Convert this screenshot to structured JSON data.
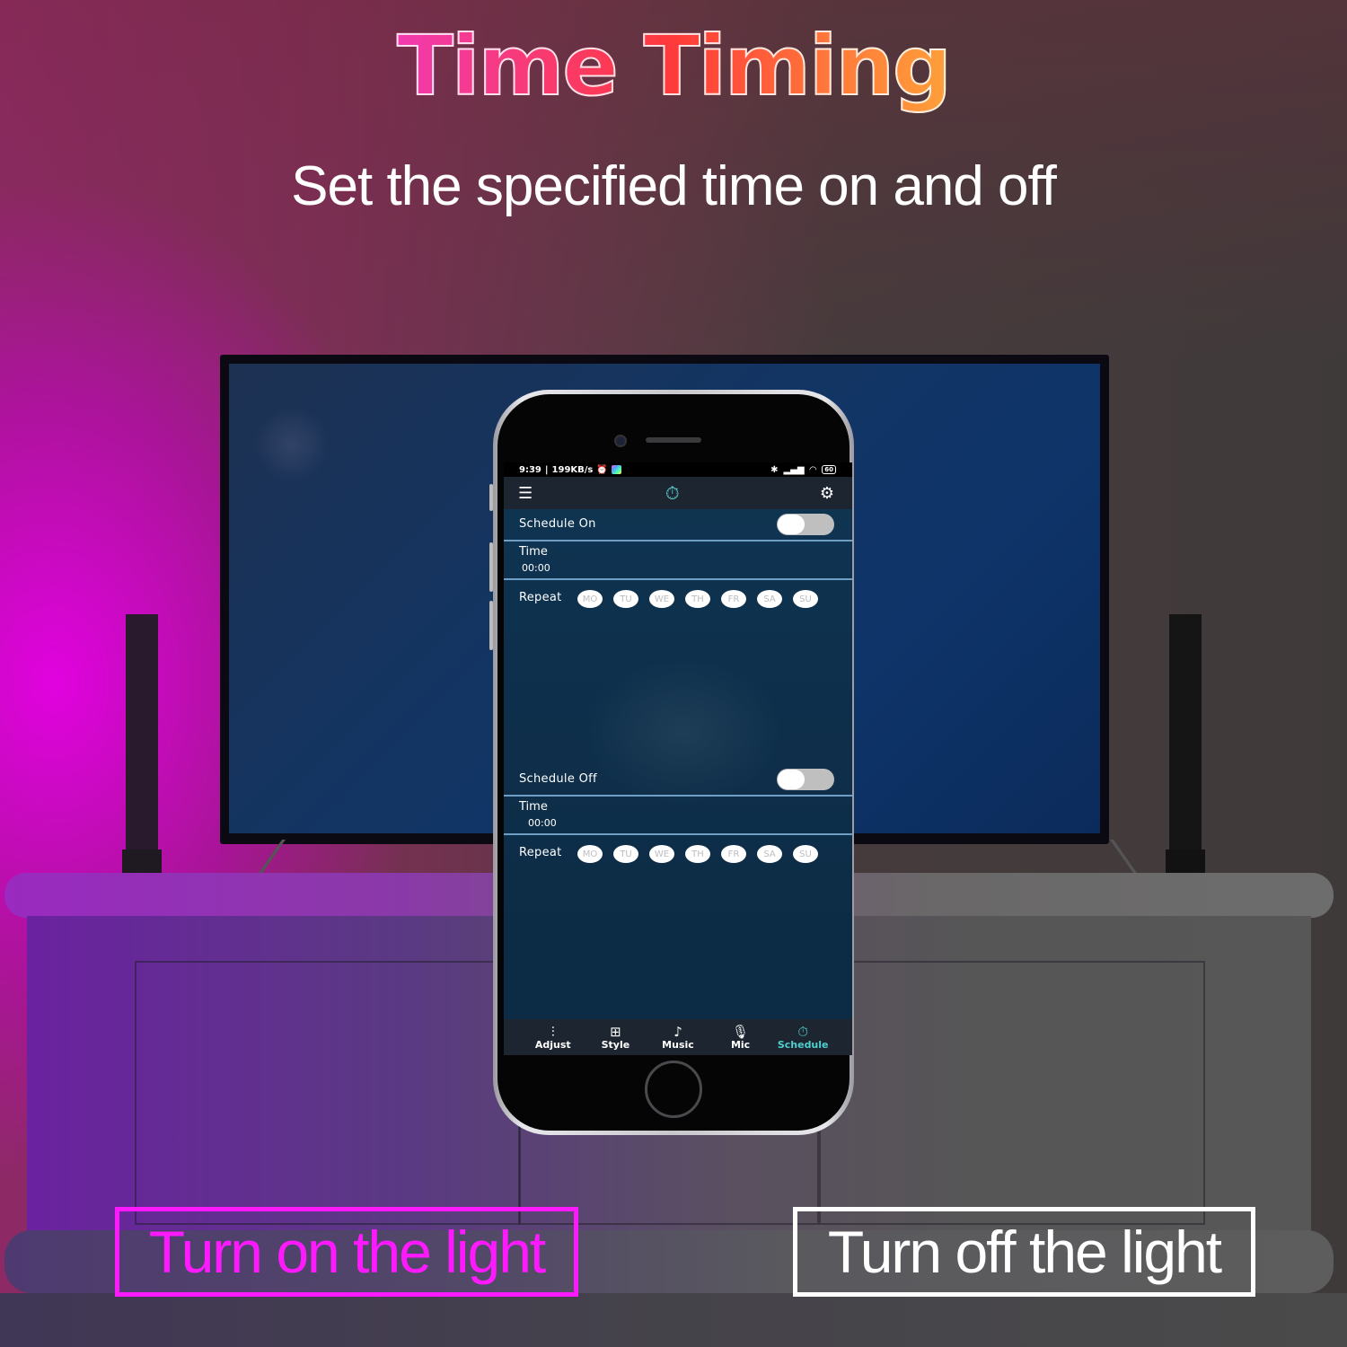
{
  "banner": {
    "title_word1": "Time",
    "title_word2": "Timing",
    "subtitle": "Set the specified time on and off"
  },
  "phone": {
    "status_bar": {
      "time": "9:39",
      "network_speed": "199KB/s",
      "battery": "60"
    },
    "app_bar": {
      "menu_icon": "list-icon",
      "center_icon": "stopwatch-icon",
      "settings_icon": "gear-icon"
    },
    "schedule_on": {
      "label": "Schedule On",
      "enabled": false,
      "time_label": "Time",
      "time_value": "00:00",
      "repeat_label": "Repeat",
      "days": [
        "MO",
        "TU",
        "WE",
        "TH",
        "FR",
        "SA",
        "SU"
      ]
    },
    "schedule_off": {
      "label": "Schedule Off",
      "enabled": false,
      "time_label": "Time",
      "time_value": "00:00",
      "repeat_label": "Repeat",
      "days": [
        "MO",
        "TU",
        "WE",
        "TH",
        "FR",
        "SA",
        "SU"
      ]
    },
    "tabs": [
      {
        "label": "Adjust",
        "icon": "sliders-icon",
        "active": false
      },
      {
        "label": "Style",
        "icon": "grid-icon",
        "active": false
      },
      {
        "label": "Music",
        "icon": "music-note-icon",
        "active": false
      },
      {
        "label": "Mic",
        "icon": "microphone-icon",
        "active": false
      },
      {
        "label": "Schedule",
        "icon": "stopwatch-icon",
        "active": true
      }
    ],
    "accent_color": "#4fcfcf"
  },
  "captions": {
    "on": "Turn on the light",
    "off": "Turn off the light",
    "on_color": "#ff19ff",
    "off_color": "#ffffff"
  }
}
